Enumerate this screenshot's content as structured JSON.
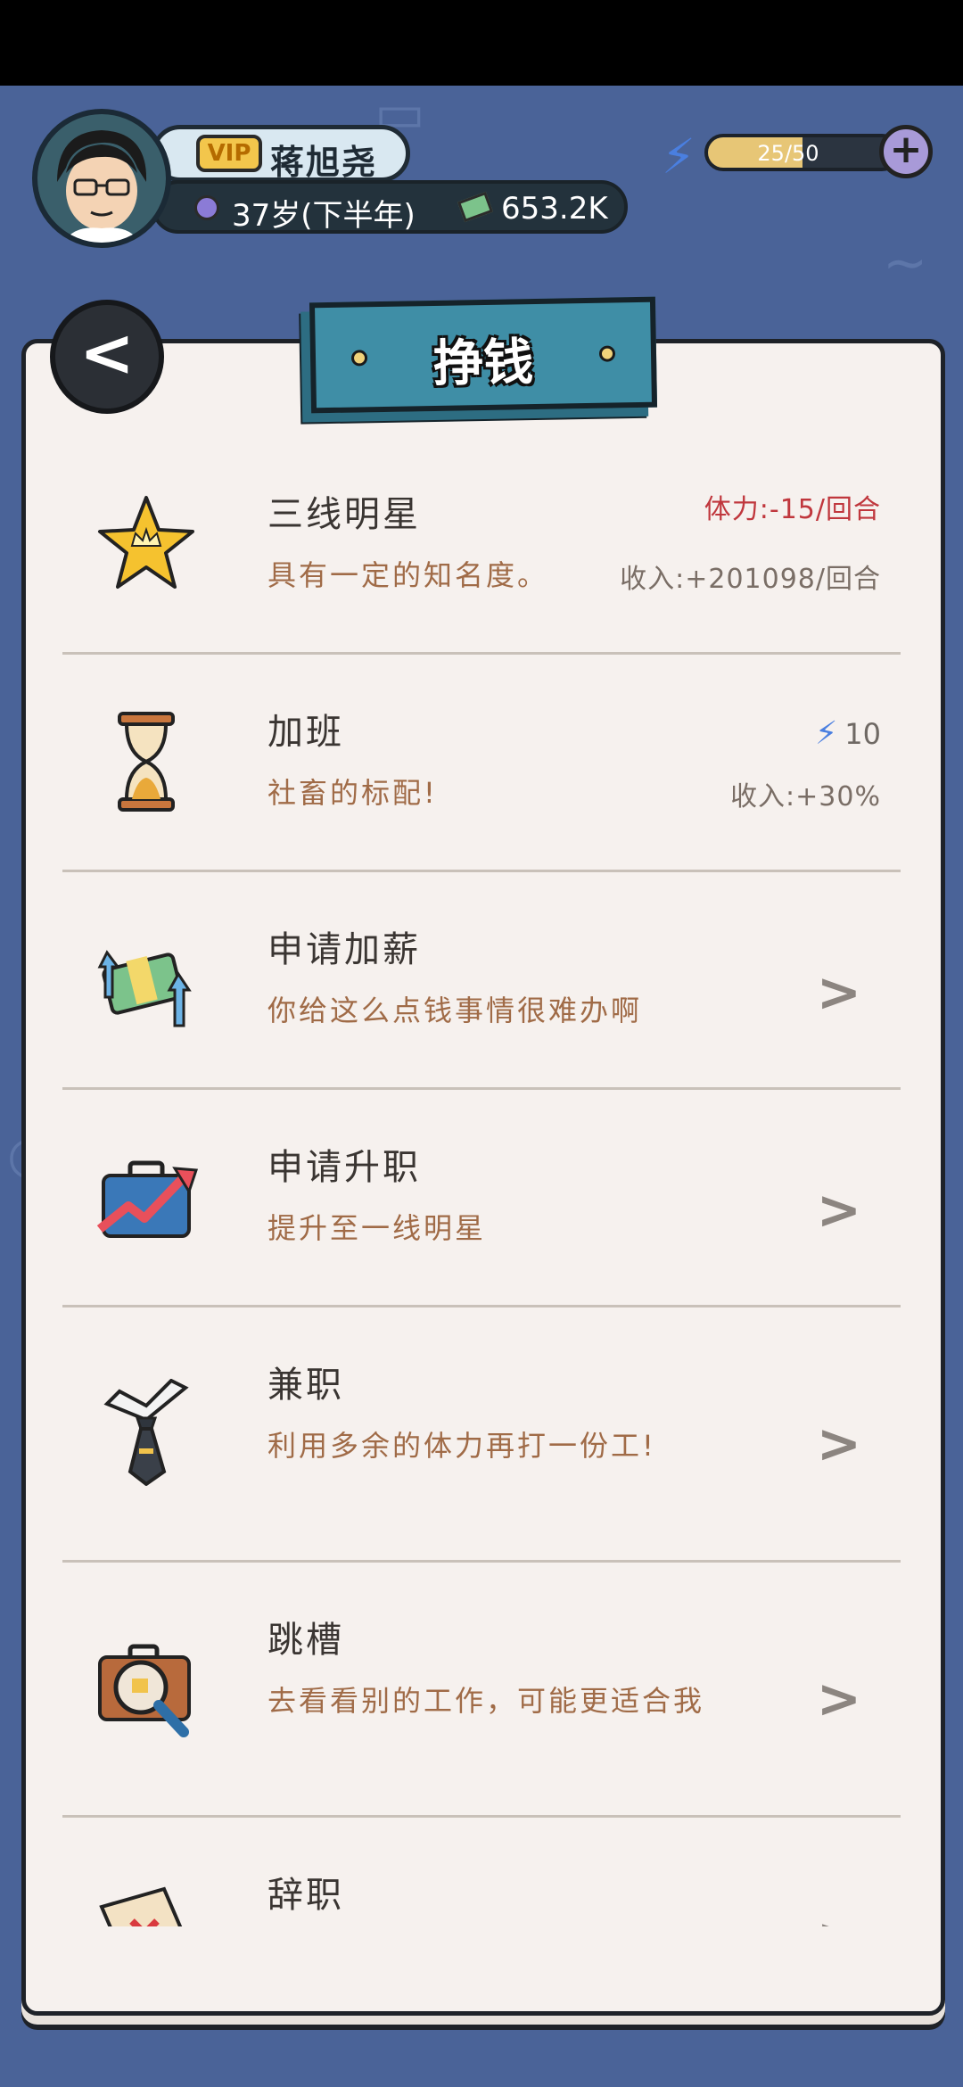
{
  "header": {
    "vip_label": "VIP",
    "player_name": "蒋旭尧",
    "age": "37岁(下半年)",
    "cash": "653.2K",
    "energy": {
      "current": 25,
      "max": 50,
      "text": "25/50",
      "fraction": 0.5
    },
    "plus": "+"
  },
  "page": {
    "title": "挣钱",
    "back": "<"
  },
  "jobs": [
    {
      "title": "三线明星",
      "desc": "具有一定的知名度。",
      "cost": "体力:-15/回合",
      "income": "收入:+201098/回合"
    },
    {
      "title": "加班",
      "desc": "社畜的标配!",
      "energy_value": "10",
      "income": "收入:+30%"
    },
    {
      "title": "申请加薪",
      "desc": "你给这么点钱事情很难办啊",
      "chevron": ">"
    },
    {
      "title": "申请升职",
      "desc": "提升至一线明星",
      "chevron": ">"
    },
    {
      "title": "兼职",
      "desc": "利用多余的体力再打一份工!",
      "chevron": ">"
    },
    {
      "title": "跳槽",
      "desc": "去看看别的工作，可能更适合我",
      "chevron": ">"
    },
    {
      "title": "辞职",
      "desc": "",
      "chevron": ">"
    }
  ],
  "icons": {
    "row0": "crown-star-icon",
    "row1": "hourglass-icon",
    "row2": "money-raise-icon",
    "row3": "briefcase-growth-icon",
    "row4": "tie-icon",
    "row5": "search-briefcase-icon",
    "row6": "resign-letter-icon"
  },
  "colors": {
    "background": "#4a6398",
    "paper": "#f6f1ee",
    "banner": "#3f8ea6",
    "cost_red": "#c0373d",
    "desc_brown": "#a06b47"
  }
}
